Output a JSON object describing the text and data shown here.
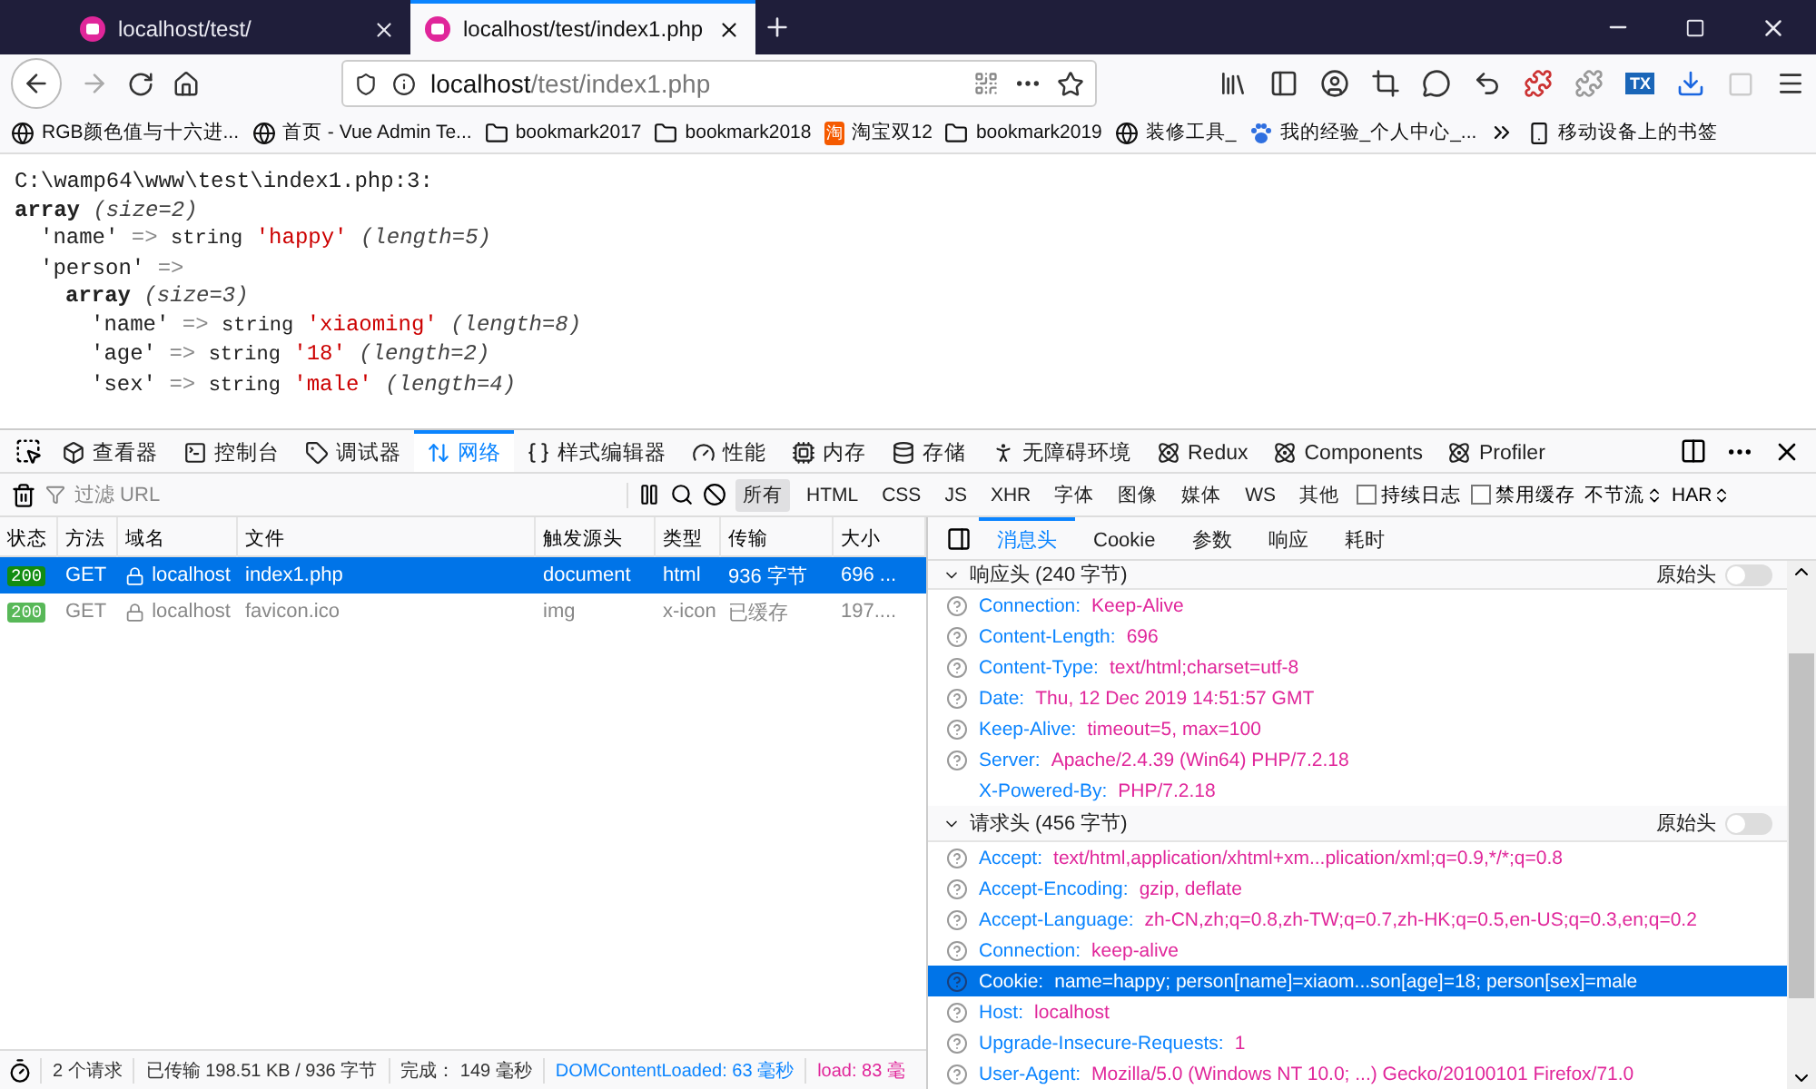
{
  "browser_tabs": [
    {
      "title": "localhost/test/",
      "selected": false
    },
    {
      "title": "localhost/test/index1.php",
      "selected": true
    }
  ],
  "address_bar": {
    "host": "localhost",
    "path": "/test/index1.php"
  },
  "extension_badge": "TX",
  "bookmarks": [
    {
      "kind": "site",
      "label": "RGB颜色值与十六进..."
    },
    {
      "kind": "site",
      "label": "首页 - Vue Admin Te..."
    },
    {
      "kind": "folder",
      "label": "bookmark2017"
    },
    {
      "kind": "folder",
      "label": "bookmark2018"
    },
    {
      "kind": "shop",
      "badge": "淘",
      "label": "淘宝双12"
    },
    {
      "kind": "folder",
      "label": "bookmark2019"
    },
    {
      "kind": "site",
      "label": "装修工具_"
    },
    {
      "kind": "paw",
      "label": "我的经验_个人中心_..."
    }
  ],
  "mobile_bookmarks": "移动设备上的书签",
  "dump": {
    "location": "C:\\wamp64\\www\\test\\index1.php:3:",
    "value": {
      "kind": "array",
      "type_label": "array",
      "size": "(size=2)",
      "entries": [
        {
          "key": "'name'",
          "arrow": "=>",
          "value": {
            "kind": "string",
            "type_label": "string",
            "text": "'happy'",
            "length": "(length=5)"
          }
        },
        {
          "key": "'person'",
          "arrow": "=>",
          "value": {
            "kind": "array",
            "type_label": "array",
            "size": "(size=3)",
            "entries": [
              {
                "key": "'name'",
                "arrow": "=>",
                "value": {
                  "kind": "string",
                  "type_label": "string",
                  "text": "'xiaoming'",
                  "length": "(length=8)"
                }
              },
              {
                "key": "'age'",
                "arrow": "=>",
                "value": {
                  "kind": "string",
                  "type_label": "string",
                  "text": "'18'",
                  "length": "(length=2)"
                }
              },
              {
                "key": "'sex'",
                "arrow": "=>",
                "value": {
                  "kind": "string",
                  "type_label": "string",
                  "text": "'male'",
                  "length": "(length=4)"
                }
              }
            ]
          }
        }
      ]
    }
  },
  "devtools": {
    "tabs": [
      {
        "label": "查看器",
        "selected": false
      },
      {
        "label": "控制台",
        "selected": false
      },
      {
        "label": "调试器",
        "selected": false
      },
      {
        "label": "网络",
        "selected": true
      },
      {
        "label": "样式编辑器",
        "selected": false
      },
      {
        "label": "性能",
        "selected": false
      },
      {
        "label": "内存",
        "selected": false
      },
      {
        "label": "存储",
        "selected": false
      },
      {
        "label": "无障碍环境",
        "selected": false
      },
      {
        "label": "Redux",
        "selected": false
      },
      {
        "label": "Components",
        "selected": false
      },
      {
        "label": "Profiler",
        "selected": false
      }
    ],
    "filter": {
      "placeholder": "过滤 URL"
    },
    "type_filters": [
      {
        "label": "所有",
        "selected": true
      },
      {
        "label": "HTML",
        "selected": false
      },
      {
        "label": "CSS",
        "selected": false
      },
      {
        "label": "JS",
        "selected": false
      },
      {
        "label": "XHR",
        "selected": false
      },
      {
        "label": "字体",
        "selected": false
      },
      {
        "label": "图像",
        "selected": false
      },
      {
        "label": "媒体",
        "selected": false
      },
      {
        "label": "WS",
        "selected": false
      },
      {
        "label": "其他",
        "selected": false
      }
    ],
    "options": [
      {
        "label": "持续日志",
        "checked": false
      },
      {
        "label": "禁用缓存",
        "checked": false
      }
    ],
    "dropdowns": [
      "不节流",
      "HAR"
    ]
  },
  "requests": {
    "columns": [
      "状态",
      "方法",
      "域名",
      "文件",
      "触发源头",
      "类型",
      "传输",
      "大小"
    ],
    "rows": [
      {
        "status": "200",
        "method": "GET",
        "domain": "localhost",
        "file": "index1.php",
        "cause": "document",
        "type": "html",
        "transferred": "936 字节",
        "size": "696 ...",
        "selected": true,
        "cached": false
      },
      {
        "status": "200",
        "method": "GET",
        "domain": "localhost",
        "file": "favicon.ico",
        "cause": "img",
        "type": "x-icon",
        "transferred": "已缓存",
        "size": "197....",
        "selected": false,
        "cached": true
      }
    ]
  },
  "status_bar": [
    {
      "kind": "plain",
      "text": "2 个请求"
    },
    {
      "kind": "plain",
      "text": "已传输 198.51 KB / 936 字节"
    },
    {
      "kind": "plain",
      "text": "完成： 149 毫秒"
    },
    {
      "kind": "dom",
      "text": "DOMContentLoaded: 63 毫秒"
    },
    {
      "kind": "load",
      "text": "load: 83 毫"
    }
  ],
  "details": {
    "tabs": [
      {
        "label": "消息头",
        "selected": true
      },
      {
        "label": "Cookie",
        "selected": false
      },
      {
        "label": "参数",
        "selected": false
      },
      {
        "label": "响应",
        "selected": false
      },
      {
        "label": "耗时",
        "selected": false
      }
    ],
    "sections": [
      {
        "title": "响应头 (240 字节)",
        "raw_label": "原始头",
        "raw_on": false,
        "expanded": true,
        "headers": [
          {
            "name": "Connection:",
            "value": "Keep-Alive",
            "help": true,
            "selected": false
          },
          {
            "name": "Content-Length:",
            "value": "696",
            "help": true,
            "selected": false
          },
          {
            "name": "Content-Type:",
            "value": "text/html;charset=utf-8",
            "help": true,
            "selected": false
          },
          {
            "name": "Date:",
            "value": "Thu, 12 Dec 2019 14:51:57 GMT",
            "help": true,
            "selected": false
          },
          {
            "name": "Keep-Alive:",
            "value": "timeout=5, max=100",
            "help": true,
            "selected": false
          },
          {
            "name": "Server:",
            "value": "Apache/2.4.39 (Win64) PHP/7.2.18",
            "help": true,
            "selected": false
          },
          {
            "name": "X-Powered-By:",
            "value": "PHP/7.2.18",
            "help": false,
            "selected": false
          }
        ]
      },
      {
        "title": "请求头 (456 字节)",
        "raw_label": "原始头",
        "raw_on": false,
        "expanded": true,
        "headers": [
          {
            "name": "Accept:",
            "value": "text/html,application/xhtml+xm...plication/xml;q=0.9,*/*;q=0.8",
            "help": true,
            "selected": false
          },
          {
            "name": "Accept-Encoding:",
            "value": "gzip, deflate",
            "help": true,
            "selected": false
          },
          {
            "name": "Accept-Language:",
            "value": "zh-CN,zh;q=0.8,zh-TW;q=0.7,zh-HK;q=0.5,en-US;q=0.3,en;q=0.2",
            "help": true,
            "selected": false
          },
          {
            "name": "Connection:",
            "value": "keep-alive",
            "help": true,
            "selected": false
          },
          {
            "name": "Cookie:",
            "value": "name=happy; person[name]=xiaom...son[age]=18; person[sex]=male",
            "help": true,
            "selected": true
          },
          {
            "name": "Host:",
            "value": "localhost",
            "help": true,
            "selected": false
          },
          {
            "name": "Upgrade-Insecure-Requests:",
            "value": "1",
            "help": true,
            "selected": false
          },
          {
            "name": "User-Agent:",
            "value": "Mozilla/5.0 (Windows NT 10.0; ...) Gecko/20100101 Firefox/71.0",
            "help": true,
            "selected": false
          }
        ]
      }
    ]
  }
}
